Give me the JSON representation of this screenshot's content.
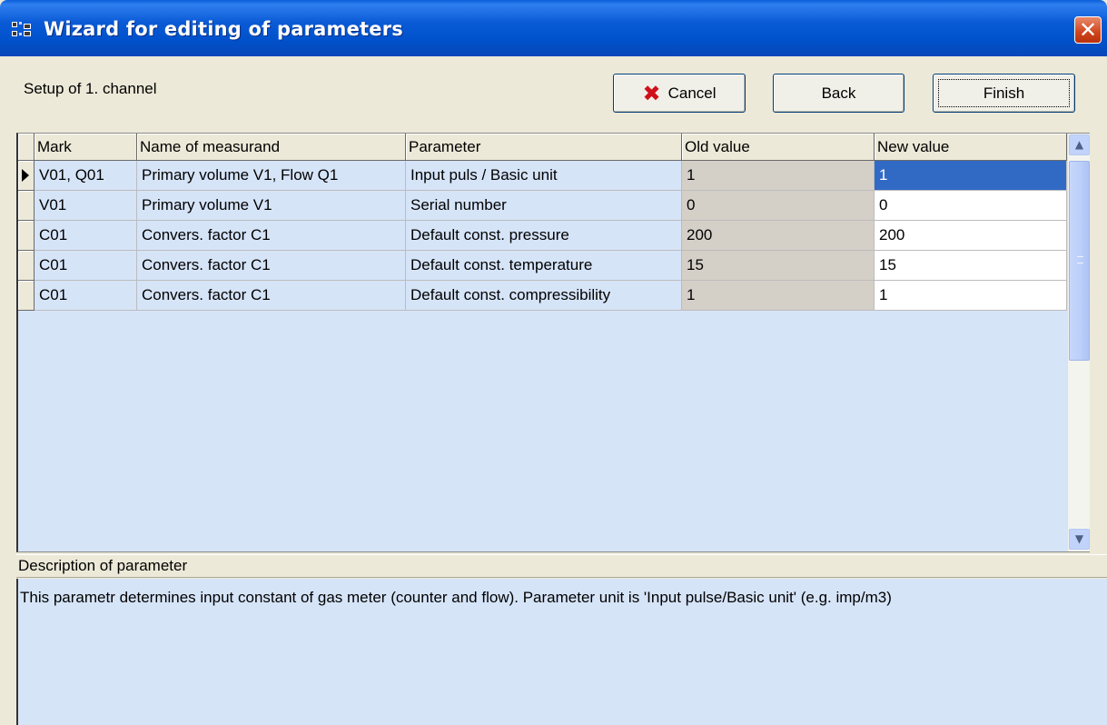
{
  "window": {
    "title": "Wizard for editing  of parameters",
    "close_label": "✕"
  },
  "header": {
    "setup_label": "Setup of 1. channel",
    "cancel_label": "Cancel",
    "back_label": "Back",
    "finish_label": "Finish"
  },
  "grid": {
    "columns": [
      "Mark",
      "Name of measurand",
      "Parameter",
      "Old value",
      "New value"
    ],
    "rows": [
      {
        "mark": "V01, Q01",
        "name": "Primary volume V1, Flow Q1",
        "parameter": "Input puls / Basic unit",
        "old": "1",
        "new": "1"
      },
      {
        "mark": "V01",
        "name": "Primary volume V1",
        "parameter": "Serial number",
        "old": "0",
        "new": "0"
      },
      {
        "mark": "C01",
        "name": "Convers. factor C1",
        "parameter": "Default const. pressure",
        "old": "200",
        "new": "200"
      },
      {
        "mark": "C01",
        "name": "Convers. factor C1",
        "parameter": "Default const. temperature",
        "old": "15",
        "new": "15"
      },
      {
        "mark": "C01",
        "name": "Convers. factor C1",
        "parameter": "Default const. compressibility",
        "old": "1",
        "new": "1"
      }
    ]
  },
  "description": {
    "label": "Description of parameter",
    "text": "This parametr determines input constant of gas meter (counter and flow). Parameter unit is 'Input pulse/Basic unit' (e.g. imp/m3)"
  },
  "colors": {
    "titlebar": "#0a5ad6",
    "selection": "#316ac5",
    "grid_bg": "#d6e4f8",
    "cancel_x": "#d0101a"
  },
  "icons": {
    "app": "wizard-grid-icon",
    "close": "close-icon",
    "cancel": "red-x-icon",
    "row_indicator": "row-pointer-icon"
  }
}
